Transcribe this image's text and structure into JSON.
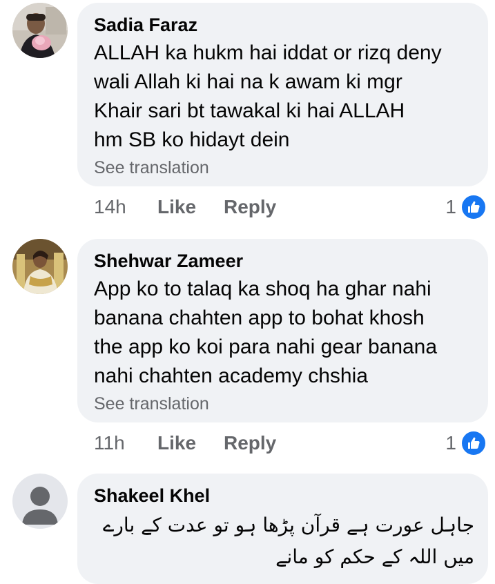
{
  "comments": [
    {
      "author": "Sadia Faraz",
      "text": "ALLAH ka hukm hai iddat or rizq deny\nwali Allah ki hai na k awam ki mgr\nKhair sari bt tawakal ki hai ALLAH\nhm SB ko hidayt dein",
      "translation_label": "See translation",
      "time": "14h",
      "like_label": "Like",
      "reply_label": "Reply",
      "reaction_count": "1"
    },
    {
      "author": "Shehwar Zameer",
      "text": "App ko to talaq ka shoq ha ghar nahi\nbanana chahten app to bohat khosh\nthe app ko koi para nahi gear banana\nnahi chahten academy chshia",
      "translation_label": "See translation",
      "time": "11h",
      "like_label": "Like",
      "reply_label": "Reply",
      "reaction_count": "1"
    },
    {
      "author": "Shakeel Khel",
      "text": "جاہل عورت ہے قرآن پڑھا ہو تو عدت کے بارے\nمیں اللہ کے حکم کو مانے"
    }
  ],
  "colors": {
    "bubble_bg": "#f0f2f5",
    "meta_text": "#65676b",
    "like_blue": "#1877f2"
  },
  "icons": {
    "reaction": "like-reaction-icon"
  }
}
